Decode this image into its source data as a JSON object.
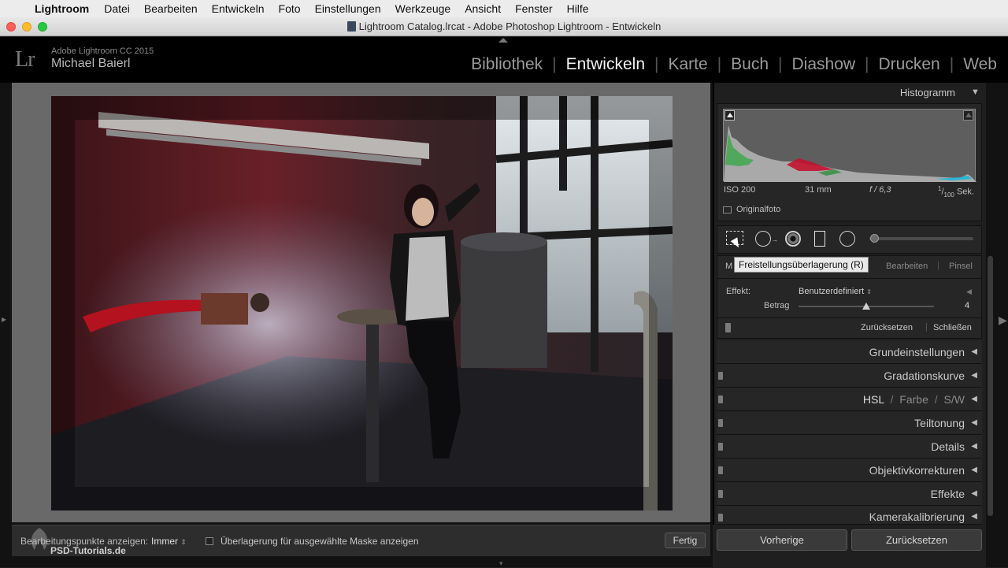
{
  "menubar": {
    "app": "Lightroom",
    "items": [
      "Datei",
      "Bearbeiten",
      "Entwickeln",
      "Foto",
      "Einstellungen",
      "Werkzeuge",
      "Ansicht",
      "Fenster",
      "Hilfe"
    ]
  },
  "window": {
    "title": "Lightroom Catalog.lrcat - Adobe Photoshop Lightroom - Entwickeln"
  },
  "identity": {
    "logo": "Lr",
    "app_version": "Adobe Lightroom CC 2015",
    "user": "Michael Baierl"
  },
  "modules": {
    "items": [
      "Bibliothek",
      "Entwickeln",
      "Karte",
      "Buch",
      "Diashow",
      "Drucken",
      "Web"
    ],
    "active": "Entwickeln"
  },
  "histogram": {
    "title": "Histogramm",
    "iso": "ISO 200",
    "focal": "31 mm",
    "aperture": "f / 6,3",
    "shutter_num": "1",
    "shutter_den": "100",
    "shutter_unit": "Sek.",
    "original_label": "Originalfoto"
  },
  "tools": {
    "icons": [
      "crop-overlay-icon",
      "spot-removal-icon",
      "red-eye-icon",
      "graduated-filter-icon",
      "radial-filter-icon",
      "adjustment-brush-slider-icon"
    ],
    "tooltip": "Freistellungsüberlagerung (R)"
  },
  "mask_panel": {
    "tab_left": "M",
    "tab_right_1": "Bearbeiten",
    "tab_right_2": "Pinsel",
    "effect_label": "Effekt:",
    "effect_value": "Benutzerdefiniert",
    "amount_label": "Betrag",
    "amount_value": "4",
    "amount_fraction": 0.5,
    "reset": "Zurücksetzen",
    "close": "Schließen"
  },
  "panels": {
    "grund": "Grundeinstellungen",
    "gradation": "Gradationskurve",
    "hsl": "HSL",
    "farbe": "Farbe",
    "sw": "S/W",
    "slash": "/",
    "teiltonung": "Teiltonung",
    "details": "Details",
    "objektiv": "Objektivkorrekturen",
    "effekte": "Effekte",
    "kamera": "Kamerakalibrierung"
  },
  "footer_buttons": {
    "previous": "Vorherige",
    "reset": "Zurücksetzen"
  },
  "toolbar": {
    "points_label": "Bearbeitungspunkte anzeigen:",
    "points_value": "Immer",
    "overlay_label": "Überlagerung für ausgewählte Maske anzeigen",
    "done": "Fertig"
  },
  "watermark": "PSD-Tutorials.de",
  "colors": {
    "active_module": "#f2f2f2",
    "inactive_module": "#9a9a9a",
    "panel_bg": "#1f1f1f"
  }
}
